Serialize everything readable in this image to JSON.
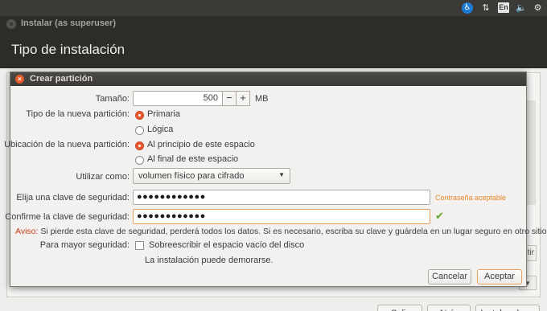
{
  "top_panel": {
    "accessibility_icon": "accessibility-icon",
    "network_icon": "network-icon",
    "keyboard_layout": "En",
    "volume_icon": "volume-icon",
    "settings_icon": "gear-icon"
  },
  "installer": {
    "window_title": "Instalar (as superuser)",
    "heading": "Tipo de instalación",
    "right_control_label": "tir",
    "buttons": {
      "quit": "Salir",
      "back": "Atrás",
      "install": "Instalar ahora"
    }
  },
  "dialog": {
    "title": "Crear partición",
    "size": {
      "label": "Tamaño:",
      "value": "500",
      "minus": "−",
      "plus": "+",
      "unit": "MB"
    },
    "partition_type": {
      "label": "Tipo de la nueva partición:",
      "options": [
        {
          "label": "Primaria",
          "selected": true
        },
        {
          "label": "Lógica",
          "selected": false
        }
      ]
    },
    "location": {
      "label": "Ubicación de la nueva partición:",
      "options": [
        {
          "label": "Al principio de este espacio",
          "selected": true
        },
        {
          "label": "Al final de este espacio",
          "selected": false
        }
      ]
    },
    "use_as": {
      "label": "Utilizar como:",
      "value": "volumen físico para cifrado"
    },
    "password": {
      "label": "Elija una clave de seguridad:",
      "value": "●●●●●●●●●●●●",
      "status": "Contraseña aceptable"
    },
    "confirm": {
      "label": "Confirme la clave de seguridad:",
      "value": "●●●●●●●●●●●●"
    },
    "warning": {
      "prefix": "Aviso:",
      "text": " Si pierde esta clave de seguridad, perderá todos los datos. Si es necesario, escriba su clave y guárdela en un lugar seguro en otro sitio."
    },
    "extra_security": {
      "label": "Para mayor seguridad:",
      "checkbox_label": "Sobreescribir el espacio vacío del disco",
      "checked": false,
      "note": "La instalación puede demorarse."
    },
    "buttons": {
      "cancel": "Cancelar",
      "accept": "Aceptar"
    }
  },
  "colors": {
    "accent": "#e9582f",
    "ok": "#5fa82b",
    "warning": "#d23b1e",
    "status": "#e9862a"
  }
}
